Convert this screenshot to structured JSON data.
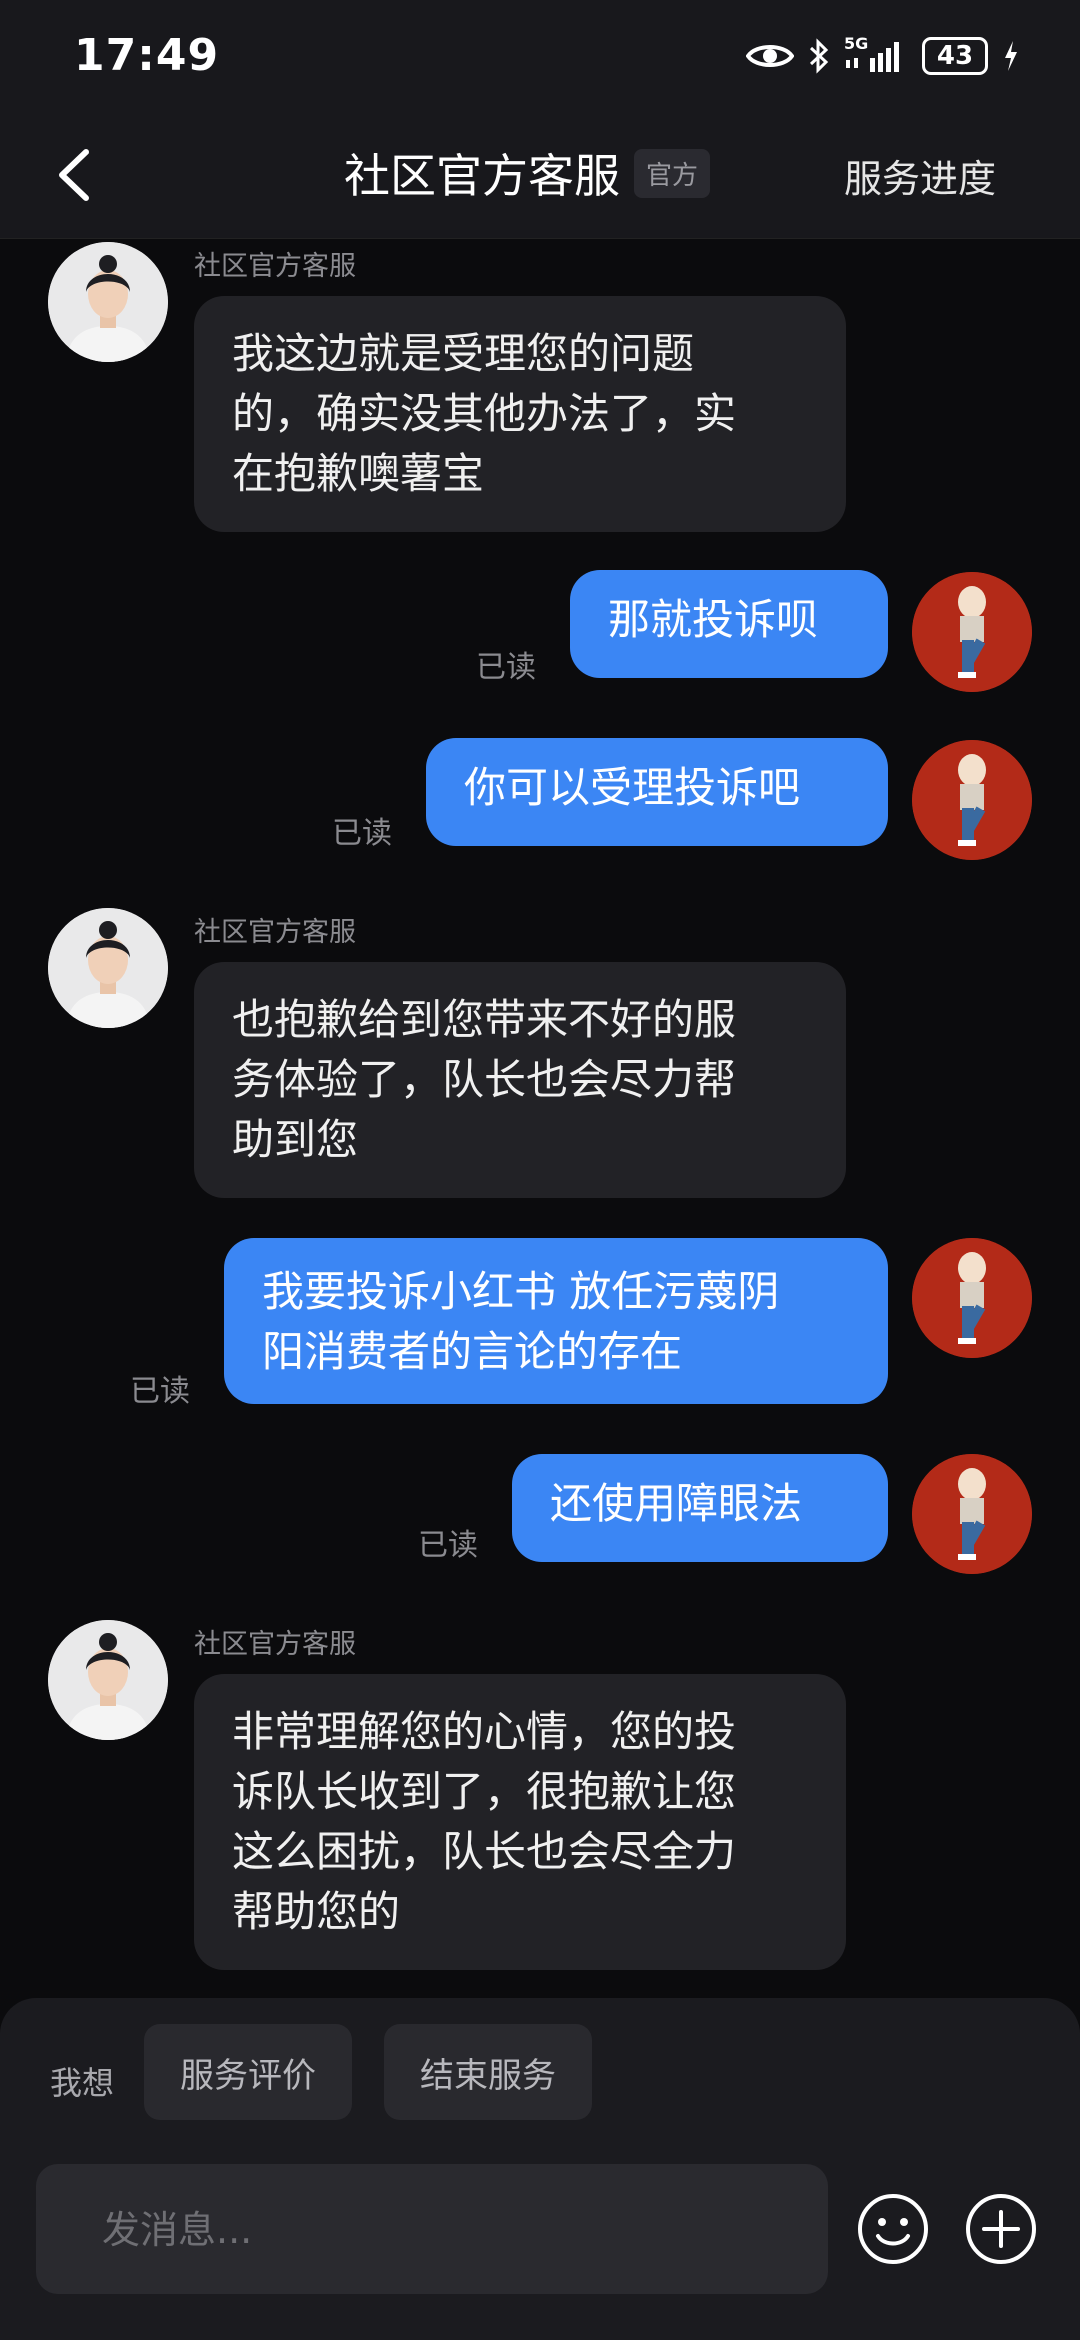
{
  "status": {
    "time": "17:49",
    "battery": "43",
    "network": "5G"
  },
  "header": {
    "title": "社区官方客服",
    "badge": "官方",
    "progress": "服务进度"
  },
  "agent_name": "社区官方客服",
  "messages": [
    {
      "type": "in",
      "sender": "社区官方客服",
      "lines": [
        "我这边就是受理您的问题",
        "的，确实没其他办法了，实",
        "在抱歉噢薯宝"
      ]
    },
    {
      "type": "out",
      "text": "那就投诉呗",
      "status": "已读"
    },
    {
      "type": "out",
      "text": "你可以受理投诉吧",
      "status": "已读"
    },
    {
      "type": "in",
      "sender": "社区官方客服",
      "lines": [
        "也抱歉给到您带来不好的服",
        "务体验了，队长也会尽力帮",
        "助到您"
      ]
    },
    {
      "type": "out",
      "lines": [
        "我要投诉小红书 放任污蔑阴",
        "阳消费者的言论的存在"
      ],
      "status": "已读"
    },
    {
      "type": "out",
      "text": "还使用障眼法",
      "status": "已读"
    },
    {
      "type": "in",
      "sender": "社区官方客服",
      "lines": [
        "非常理解您的心情，您的投",
        "诉队长收到了，很抱歉让您",
        "这么困扰，队长也会尽全力",
        "帮助您的"
      ]
    }
  ],
  "bottom": {
    "want_label": "我想",
    "chips": [
      "服务评价",
      "结束服务"
    ],
    "input_placeholder": "发消息..."
  },
  "colors": {
    "bubble_out": "#3b86f4",
    "bubble_in": "#222226",
    "background": "#0b0b0d"
  }
}
